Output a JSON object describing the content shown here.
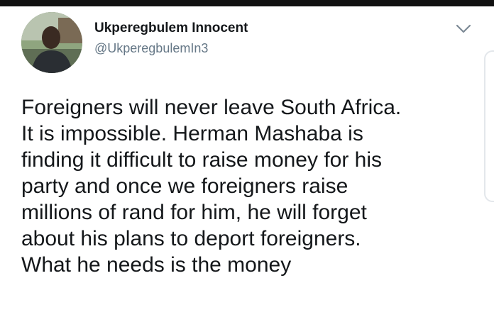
{
  "tweet": {
    "display_name": "Ukperegbulem Innocent",
    "handle": "@UkperegbulemIn3",
    "lines": [
      "Foreigners will never leave South Africa.",
      "It is impossible. Herman Mashaba is",
      "finding it difficult to raise money for his",
      "party and once we foreigners raise",
      "millions of rand for him, he will forget",
      "about his plans to deport foreigners.",
      "What he needs is the money"
    ]
  },
  "icons": {
    "avatar": "user-photo",
    "menu": "chevron-down-icon"
  },
  "colors": {
    "text": "#14171a",
    "secondary": "#657786",
    "top_bar": "#111111"
  }
}
